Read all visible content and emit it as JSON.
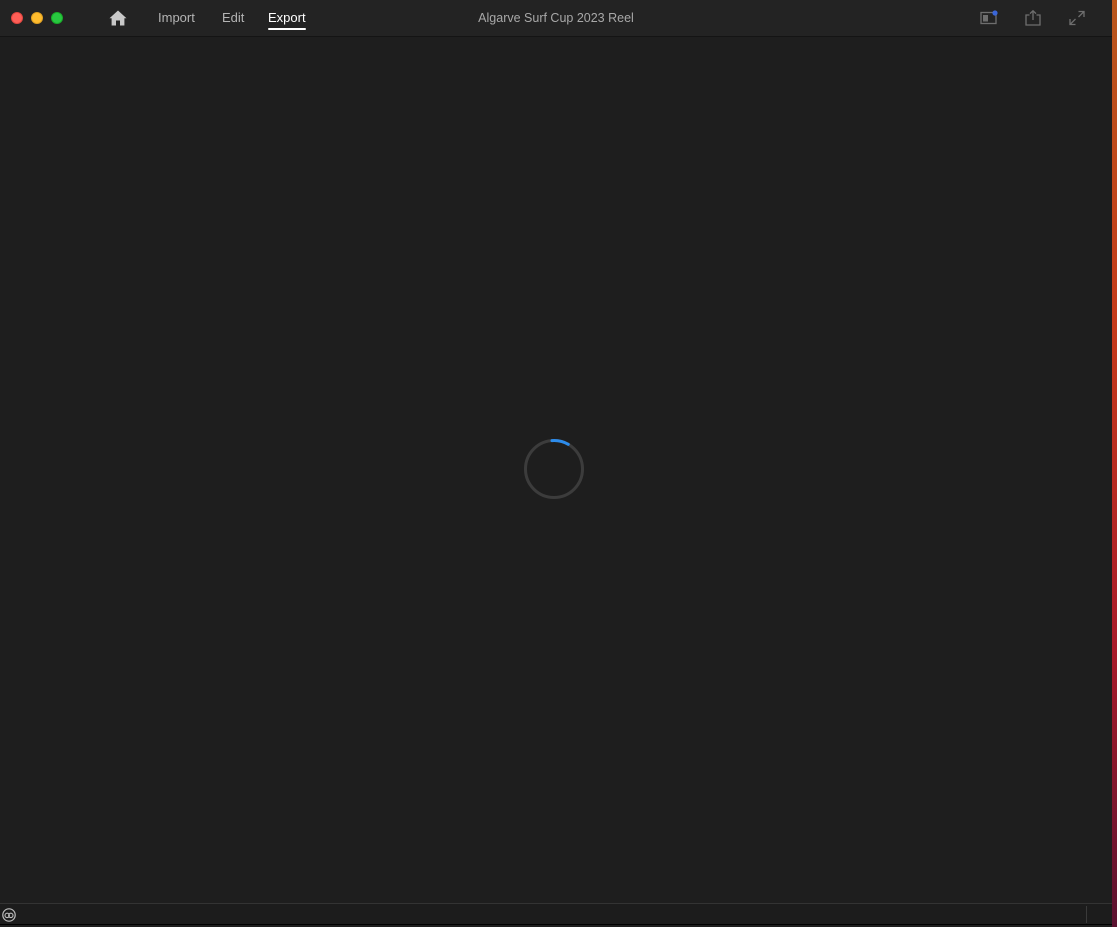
{
  "window": {
    "title": "Algarve Surf Cup 2023 Reel"
  },
  "nav": {
    "home_icon": "home-icon",
    "tabs": [
      {
        "label": "Import",
        "active": false
      },
      {
        "label": "Edit",
        "active": false
      },
      {
        "label": "Export",
        "active": true
      }
    ]
  },
  "toolbar_icons": [
    "workspace-panel-icon",
    "share-icon",
    "fullscreen-icon"
  ],
  "status": {
    "loading": true,
    "app_icon": "creative-cloud-icon"
  },
  "colors": {
    "background": "#1e1e1e",
    "titlebar": "#232323",
    "spinner_track": "#3c3c3c",
    "spinner_accent": "#2d8ceb",
    "active_tab": "#ffffff",
    "inactive_tab": "#b4b4b4"
  }
}
